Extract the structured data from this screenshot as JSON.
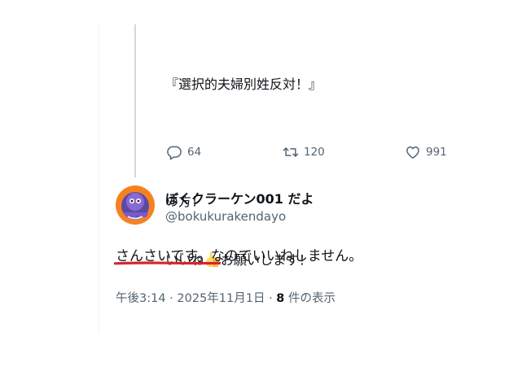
{
  "quoted_tweet": {
    "lines": [
      "『選択的夫婦別姓反対！』",
      "",
      "の方！",
      "いいね",
      "お願いします！"
    ],
    "emoji": "thumbs-up-icon"
  },
  "actions": {
    "reply_count": "64",
    "retweet_count": "120",
    "like_count": "991"
  },
  "reply": {
    "author_name": "ぼくクラーケン001 だよ",
    "author_handle": "@bokukurakendayo",
    "text_underlined": "さんさいです",
    "text_rest": "。なのでいいねしません。",
    "time": "午後3:14",
    "sep1": " · ",
    "date": "2025年11月1日",
    "sep2": " · ",
    "views_count": "8",
    "views_label": " 件の表示"
  },
  "colors": {
    "text_primary": "#0f1419",
    "text_secondary": "#536471",
    "thread_line": "#cfd9de",
    "annotation_red": "#d9242c",
    "avatar_bg": "#f58220"
  }
}
